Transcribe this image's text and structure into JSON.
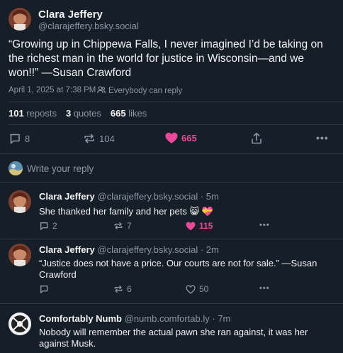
{
  "main_post": {
    "author_name": "Clara Jeffery",
    "author_handle": "@clarajeffery.bsky.social",
    "text": "“Growing up in Chippewa Falls, I never imagined I’d be taking on the richest man in the world for justice in Wisconsin—and we won!!” —Susan Crawford",
    "timestamp": "April 1, 2025 at 7:38 PM",
    "reply_setting": "Everybody can reply",
    "stats": {
      "reposts_count": "101",
      "reposts_label": "reposts",
      "quotes_count": "3",
      "quotes_label": "quotes",
      "likes_count": "665",
      "likes_label": "likes"
    },
    "actions": {
      "replies": "8",
      "reposts": "104",
      "likes": "665"
    }
  },
  "composer": {
    "placeholder": "Write your reply"
  },
  "replies": [
    {
      "author_name": "Clara Jeffery",
      "author_handle": "@clarajeffery.bsky.social",
      "time": "· 5m",
      "text": "She thanked her family and her pets 😸 💝",
      "replies": "2",
      "reposts": "7",
      "likes": "115",
      "liked": true
    },
    {
      "author_name": "Clara Jeffery",
      "author_handle": "@clarajeffery.bsky.social",
      "time": "· 2m",
      "text": "“Justice does not have a price. Our courts are not for sale.” —Susan Crawford",
      "replies": "",
      "reposts": "6",
      "likes": "50",
      "liked": false
    },
    {
      "author_name": "Comfortably Numb",
      "author_handle": "@numb.comfortab.ly",
      "time": "· 7m",
      "text": "Nobody will remember the actual pawn she ran against, it was her against Musk."
    }
  ],
  "colors": {
    "background": "#161e27",
    "separator": "#2e3a47",
    "muted_text": "#8a97a6",
    "like_pink": "#ec4899"
  }
}
